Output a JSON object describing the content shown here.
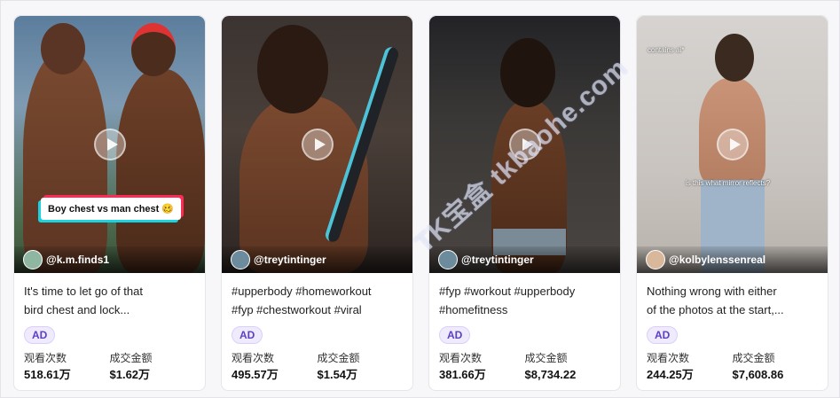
{
  "cards": [
    {
      "creator": "@k.m.finds1",
      "thumb_caption": "Boy chest vs man chest 🥴",
      "desc_line1": "It's time to let go of that",
      "desc_line2": "bird chest and lock...",
      "ad_label": "AD",
      "views_label": "观看次数",
      "views_value": "518.61万",
      "gmv_label": "成交金额",
      "gmv_value": "$1.62万"
    },
    {
      "creator": "@treytintinger",
      "desc_line1": "#upperbody #homeworkout",
      "desc_line2": "#fyp #chestworkout #viral",
      "ad_label": "AD",
      "views_label": "观看次数",
      "views_value": "495.57万",
      "gmv_label": "成交金额",
      "gmv_value": "$1.54万"
    },
    {
      "creator": "@treytintinger",
      "desc_line1": "#fyp #workout #upperbody",
      "desc_line2": "#homefitness",
      "ad_label": "AD",
      "views_label": "观看次数",
      "views_value": "381.66万",
      "gmv_label": "成交金额",
      "gmv_value": "$8,734.22"
    },
    {
      "creator": "@kolbylenssenreal",
      "thumb_tag_top": "contains ai*",
      "thumb_tag_mid": "is this what mirror reflects?",
      "desc_line1": "Nothing wrong with either",
      "desc_line2": "of the photos at the start,...",
      "ad_label": "AD",
      "views_label": "观看次数",
      "views_value": "244.25万",
      "gmv_label": "成交金额",
      "gmv_value": "$7,608.86"
    }
  ],
  "watermark": "tkbaohe.com",
  "watermark_logo": "TK宝盒"
}
